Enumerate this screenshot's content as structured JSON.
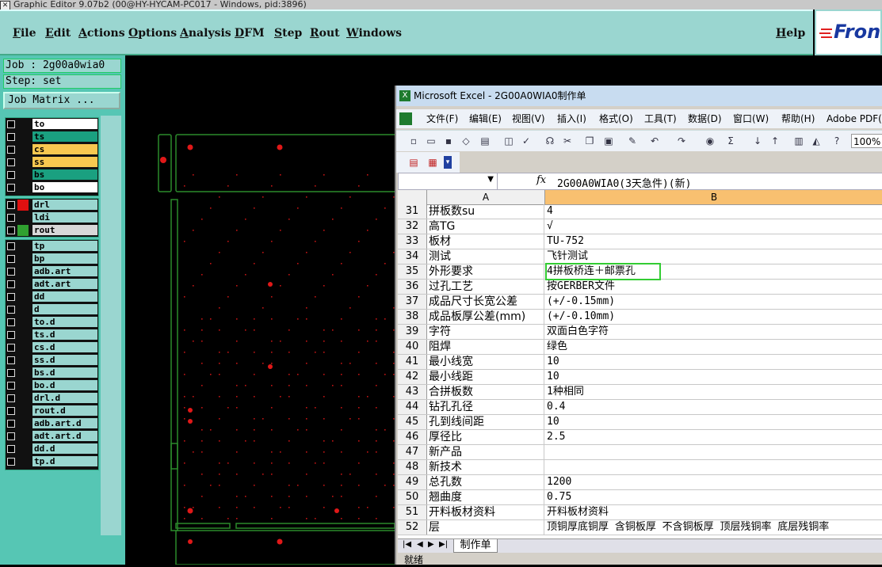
{
  "app": {
    "title": "Graphic Editor 9.07b2 (00@HY-HYCAM-PC017 - Windows, pid:3896)",
    "menu": [
      "File",
      "Edit",
      "Actions",
      "Options",
      "Analysis",
      "DFM",
      "Step",
      "Rout",
      "Windows"
    ],
    "help": "Help",
    "logo": "Fron"
  },
  "job": {
    "job_label": "Job : 2g00a0wia0",
    "step_label": "Step: set",
    "matrix_button": "Job Matrix ..."
  },
  "layers": {
    "group1": [
      {
        "name": "to",
        "color": "#ffffff"
      },
      {
        "name": "ts",
        "color": "#1aa080"
      },
      {
        "name": "cs",
        "color": "#f8c850"
      },
      {
        "name": "ss",
        "color": "#f8c850"
      },
      {
        "name": "bs",
        "color": "#1aa080"
      },
      {
        "name": "bo",
        "color": "#ffffff"
      }
    ],
    "group2": [
      {
        "name": "drl",
        "swatch": "#e01010",
        "color": "#9ad6d0"
      },
      {
        "name": "ldi",
        "swatch": "#111111",
        "color": "#9ad6d0"
      },
      {
        "name": "rout",
        "swatch": "#30a030",
        "color": "#d8d8d8"
      }
    ],
    "group3": [
      "tp",
      "bp",
      "adb.art",
      "adt.art",
      "dd",
      "d",
      "to.d",
      "ts.d",
      "cs.d",
      "ss.d",
      "bs.d",
      "bo.d",
      "drl.d",
      "rout.d",
      "adb.art.d",
      "adt.art.d",
      "dd.d",
      "tp.d"
    ]
  },
  "excel": {
    "title": "Microsoft Excel - 2G00A0WIA0制作单",
    "menu": [
      "文件(F)",
      "编辑(E)",
      "视图(V)",
      "插入(I)",
      "格式(O)",
      "工具(T)",
      "数据(D)",
      "窗口(W)",
      "帮助(H)",
      "Adobe PDF("
    ],
    "zoom": "100%",
    "fx": "fx",
    "formula_value": "2G00A0WIA0(3天急件)(新)",
    "columns": [
      "A",
      "B"
    ],
    "rows": [
      {
        "n": "31",
        "a": "拼板数su",
        "b": "4"
      },
      {
        "n": "32",
        "a": "高TG",
        "b": "√"
      },
      {
        "n": "33",
        "a": "板材",
        "b": "TU-752"
      },
      {
        "n": "34",
        "a": "测试",
        "b": "飞针测试"
      },
      {
        "n": "35",
        "a": "外形要求",
        "b": "4拼板桥连＋邮票孔"
      },
      {
        "n": "36",
        "a": "过孔工艺",
        "b": "按GERBER文件"
      },
      {
        "n": "37",
        "a": "成品尺寸长宽公差",
        "b": "(+/-0.15mm)"
      },
      {
        "n": "38",
        "a": "成品板厚公差(mm)",
        "b": "(+/-0.10mm)"
      },
      {
        "n": "39",
        "a": "字符",
        "b": "双面白色字符"
      },
      {
        "n": "40",
        "a": "阻焊",
        "b": "绿色"
      },
      {
        "n": "41",
        "a": "最小线宽",
        "b": "10"
      },
      {
        "n": "42",
        "a": "最小线距",
        "b": "10"
      },
      {
        "n": "43",
        "a": "合拼板数",
        "b": "1种相同"
      },
      {
        "n": "44",
        "a": "钻孔孔径",
        "b": "0.4"
      },
      {
        "n": "45",
        "a": "孔到线间距",
        "b": "10"
      },
      {
        "n": "46",
        "a": "厚径比",
        "b": "2.5"
      },
      {
        "n": "47",
        "a": "新产品",
        "b": ""
      },
      {
        "n": "48",
        "a": "新技术",
        "b": ""
      },
      {
        "n": "49",
        "a": "总孔数",
        "b": "1200"
      },
      {
        "n": "50",
        "a": "翘曲度",
        "b": "0.75"
      },
      {
        "n": "51",
        "a": "开料板材资料",
        "b": "开料板材资料"
      },
      {
        "n": "52",
        "a": "层",
        "b": "顶铜厚底铜厚 含铜板厚 不含铜板厚 顶层残铜率 底层残铜率"
      }
    ],
    "sheet_tab": "制作单",
    "status": "就绪"
  }
}
